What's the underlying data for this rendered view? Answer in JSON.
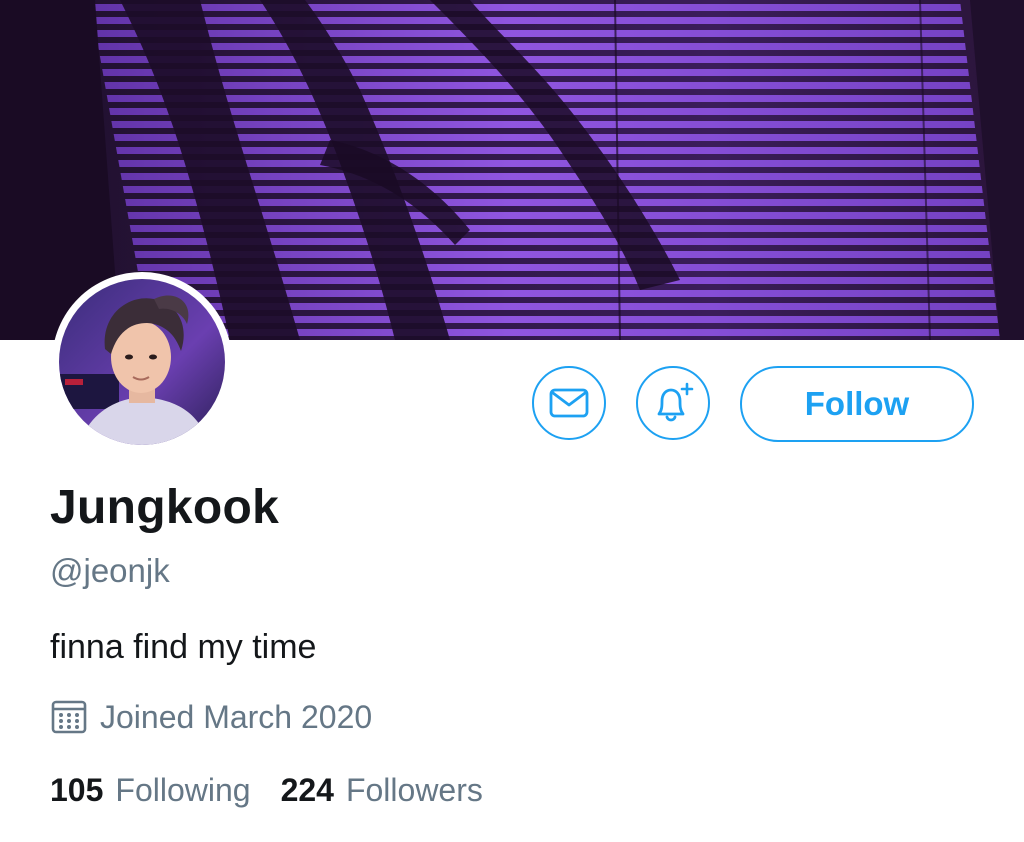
{
  "profile": {
    "display_name": "Jungkook",
    "handle": "@jeonjk",
    "bio": "finna find my time",
    "joined": "Joined March 2020"
  },
  "stats": {
    "following_count": "105",
    "following_label": "Following",
    "followers_count": "224",
    "followers_label": "Followers"
  },
  "actions": {
    "follow_label": "Follow",
    "message_icon": "envelope-icon",
    "notify_icon": "bell-plus-icon"
  },
  "colors": {
    "accent": "#1da1f2",
    "secondary_text": "#657786",
    "primary_text": "#14171a",
    "banner_purple": "#8a4fd8"
  },
  "icons": {
    "calendar": "calendar-icon"
  }
}
